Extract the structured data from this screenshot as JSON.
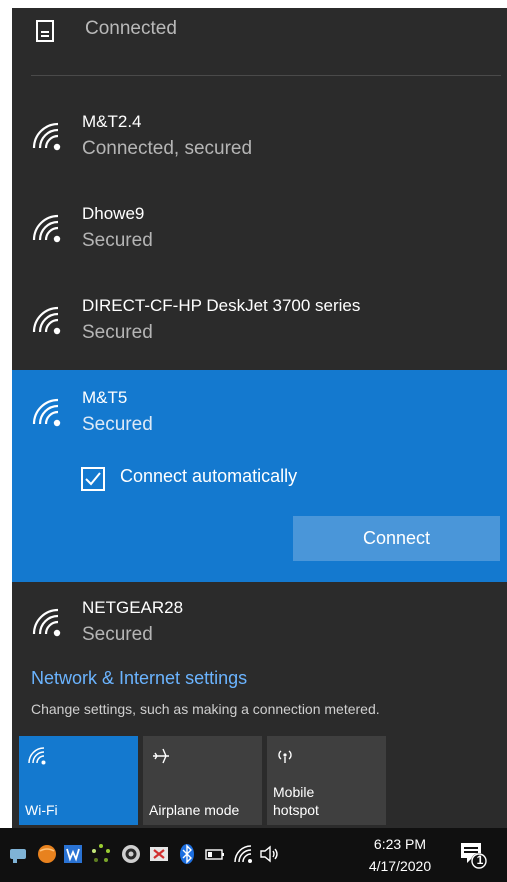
{
  "wired": {
    "status": "Connected",
    "icon": "monitor-icon"
  },
  "networks": [
    {
      "name": "M&T2.4",
      "status": "Connected, secured",
      "icon": "wifi-secured-icon"
    },
    {
      "name": "Dhowe9",
      "status": "Secured",
      "icon": "wifi-secured-icon"
    },
    {
      "name": "DIRECT-CF-HP DeskJet 3700 series",
      "status": "Secured",
      "icon": "wifi-secured-icon"
    },
    {
      "name": "M&T5",
      "status": "Secured",
      "icon": "wifi-secured-icon",
      "connect_automatically_label": "Connect automatically",
      "connect_automatically_checked": true,
      "connect_label": "Connect"
    },
    {
      "name": "NETGEAR28",
      "status": "Secured",
      "icon": "wifi-secured-icon"
    }
  ],
  "settings": {
    "link": "Network & Internet settings",
    "description": "Change settings, such as making a connection metered."
  },
  "quick_actions": [
    {
      "label": "Wi-Fi",
      "icon": "wifi-icon",
      "active": true
    },
    {
      "label": "Airplane mode",
      "icon": "airplane-icon",
      "active": false
    },
    {
      "label_line1": "Mobile",
      "label_line2": "hotspot",
      "icon": "hotspot-icon",
      "active": false
    }
  ],
  "taskbar": {
    "time": "6:23 PM",
    "date": "4/17/2020",
    "notification_count": "1"
  },
  "colors": {
    "panel": "#2b2b2b",
    "accent": "#1479cf",
    "link": "#6bb4ff",
    "taskbar": "#101010"
  }
}
